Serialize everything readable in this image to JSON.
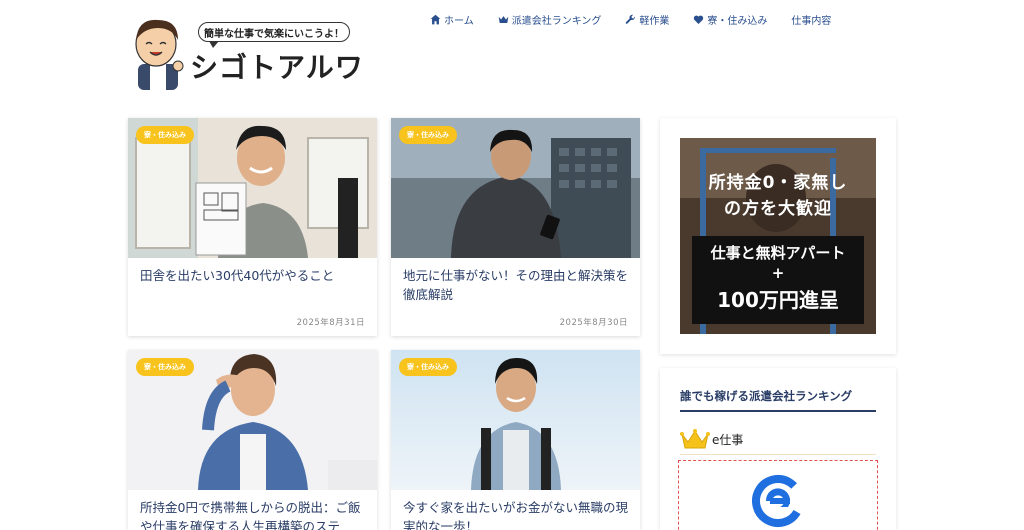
{
  "header": {
    "bubble_text": "簡単な仕事で気楽にいこうよ！",
    "site_title": "シゴトアルワ"
  },
  "nav": [
    {
      "label": "ホーム",
      "icon": "home-icon"
    },
    {
      "label": "派遣会社ランキング",
      "icon": "crown-icon"
    },
    {
      "label": "軽作業",
      "icon": "wrench-icon"
    },
    {
      "label": "寮・住み込み",
      "icon": "heart-icon"
    },
    {
      "label": "仕事内容",
      "icon": ""
    }
  ],
  "articles": [
    {
      "badge": "寮・住み込み",
      "title": "田舎を出たい30代40代がやること",
      "date": "2025年8月31日"
    },
    {
      "badge": "寮・住み込み",
      "title": "地元に仕事がない！その理由と解決策を徹底解説",
      "date": "2025年8月30日"
    },
    {
      "badge": "寮・住み込み",
      "title": "所持金0円で携帯無しからの脱出：ご飯や仕事を確保する人生再構築のステ",
      "date": ""
    },
    {
      "badge": "寮・住み込み",
      "title": "今すぐ家を出たいがお金がない無職の現実的な一歩！",
      "date": ""
    }
  ],
  "sidebar": {
    "ad": {
      "line1": "所持金0・家無し",
      "line2": "の方を大歓迎",
      "line3": "仕事と無料アパート",
      "plus": "+",
      "line4": "100万円進呈"
    },
    "ranking": {
      "heading": "誰でも稼げる派遣会社ランキング",
      "first_name": "e仕事",
      "first_icon": "crown-icon"
    }
  },
  "colors": {
    "accent": "#2a4f8f",
    "badge": "#f7c31c",
    "title_text": "#2a3d66",
    "logo_blue": "#1f6fe0"
  }
}
